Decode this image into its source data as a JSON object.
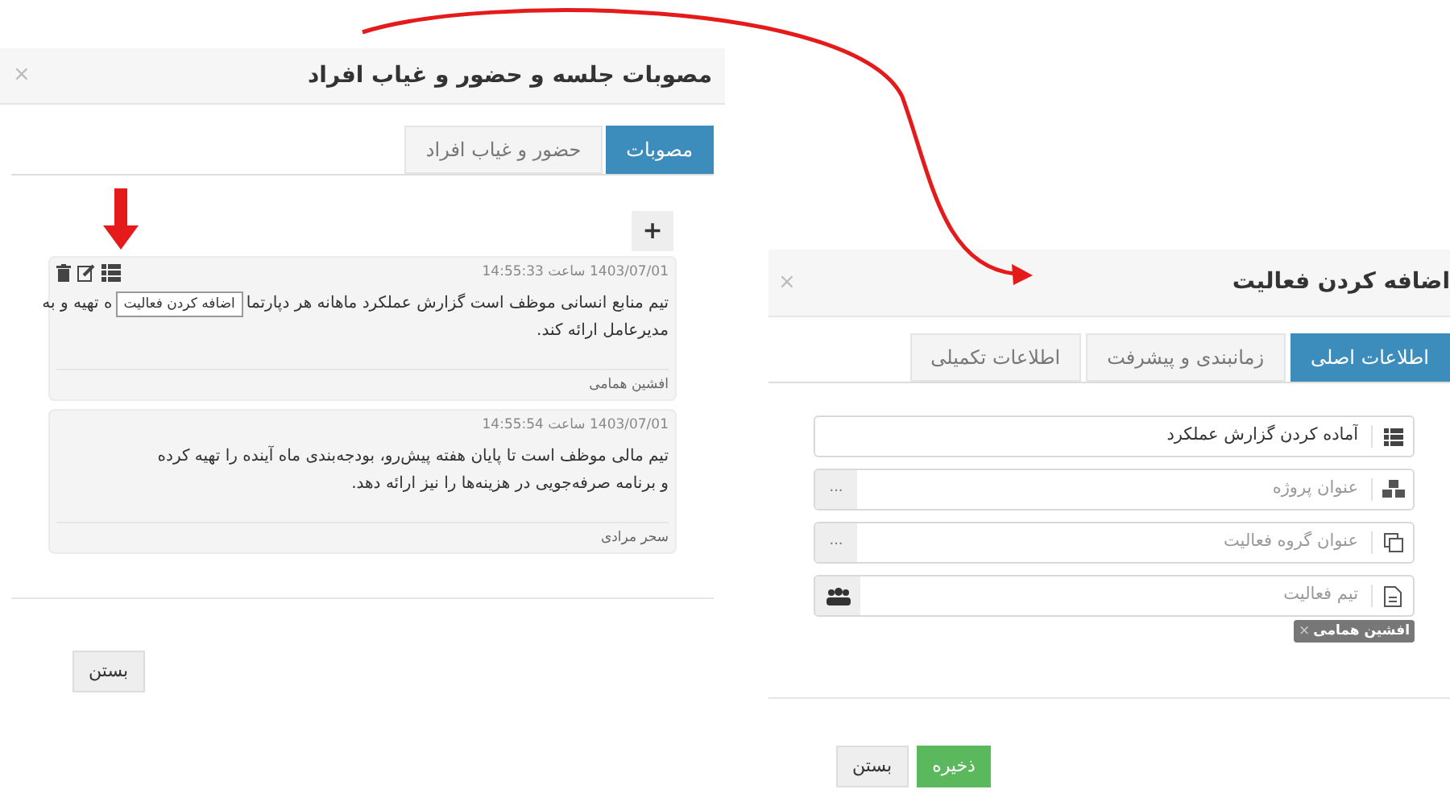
{
  "left_dialog": {
    "title": "مصوبات جلسه و حضور و غیاب افراد",
    "close": "×",
    "tabs": [
      {
        "label": "مصوبات",
        "selected": true
      },
      {
        "label": "حضور و غیاب افراد",
        "selected": false
      }
    ],
    "add_button": "+",
    "cards": [
      {
        "timestamp": "1403/07/01 ساعت 14:55:33",
        "has_actions": true,
        "text_start": "تیم منابع انسانی موظف است گزارش عملکرد ماهانه هر دپارتما",
        "tooltip": "اضافه کردن فعالیت",
        "text_end": "ه تهیه و به",
        "text_rest": "مدیرعامل ارائه کند.",
        "author": "افشین همامی"
      },
      {
        "timestamp": "1403/07/01 ساعت 14:55:54",
        "has_actions": false,
        "text_start": "تیم مالی موظف است تا پایان هفته پیش‌رو، بودجه‌بندی ماه آینده را تهیه کرده و برنامه صرفه‌جویی در هزینه‌ها را نیز ارائه دهد.",
        "author": "سحر مرادی"
      }
    ],
    "close_button": "بستن"
  },
  "right_dialog": {
    "title": "اضافه کردن فعالیت",
    "close": "×",
    "tabs": [
      {
        "label": "اطلاعات اصلی",
        "selected": true
      },
      {
        "label": "زمانبندی و پیشرفت",
        "selected": false
      },
      {
        "label": "اطلاعات تکمیلی",
        "selected": false
      }
    ],
    "fields": [
      {
        "kind": "title",
        "value": "آماده کردن گزارش عملکرد"
      },
      {
        "kind": "project",
        "placeholder": "عنوان پروژه",
        "addon": "..."
      },
      {
        "kind": "group",
        "placeholder": "عنوان گروه فعالیت",
        "addon": "..."
      },
      {
        "kind": "team",
        "placeholder": "تیم فعالیت"
      }
    ],
    "tags": [
      {
        "label": "افشین همامی",
        "remove": "×"
      }
    ],
    "buttons": [
      {
        "kind": "primary",
        "label": "ذخیره"
      },
      {
        "kind": "default",
        "label": "بستن"
      }
    ]
  }
}
